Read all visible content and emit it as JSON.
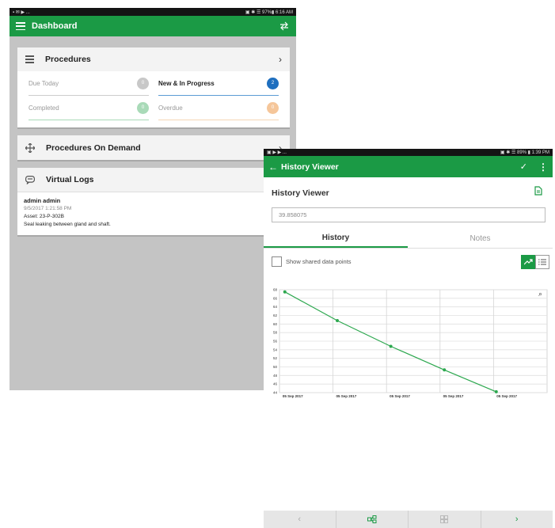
{
  "left": {
    "status": {
      "left": "▪ ✉ ▶ ...",
      "right": "▣ ✱ ☰ 97%▮ 6:16 AM"
    },
    "appbar": {
      "title": "Dashboard"
    },
    "procedures": {
      "title": "Procedures",
      "tiles": [
        {
          "label": "Due Today",
          "count": "0",
          "color": "#c8c8c8",
          "line": "#cccccc",
          "active": false
        },
        {
          "label": "New & In Progress",
          "count": "2",
          "color": "#1f6fbf",
          "line": "#5b9bd5",
          "active": true
        },
        {
          "label": "Completed",
          "count": "0",
          "color": "#a9dab8",
          "line": "#a9dab8",
          "active": false
        },
        {
          "label": "Overdue",
          "count": "0",
          "color": "#f5c69a",
          "line": "#f5d7b5",
          "active": false
        }
      ]
    },
    "on_demand": {
      "title": "Procedures On Demand"
    },
    "virtual_logs": {
      "title": "Virtual Logs",
      "user": "admin admin",
      "time": "9/5/2017 1:21:58 PM",
      "asset": "Asset: 23-P-302B",
      "note": "Seal leaking between gland and shaft."
    }
  },
  "right": {
    "status": {
      "left": "▣ ▶ ▶ ...",
      "right": "▣ ✱ ☰ 89% ▮ 1:39 PM"
    },
    "appbar": {
      "title": "History Viewer"
    },
    "page_title": "History Viewer",
    "value": "39.858075",
    "tabs": {
      "history": "History",
      "notes": "Notes"
    },
    "show_shared": "Show shared data points",
    "colors": {
      "brand": "#1b9a45",
      "line": "#2da84f"
    }
  },
  "chart_data": {
    "type": "line",
    "title": "",
    "xlabel": "",
    "ylabel": "",
    "ylim": [
      44,
      68
    ],
    "yticks": [
      44,
      46,
      48,
      50,
      52,
      54,
      56,
      58,
      60,
      62,
      64,
      66,
      68
    ],
    "xticks": [
      "05 Sep 2017",
      "05 Sep 2017",
      "05 Sep 2017",
      "05 Sep 2017",
      "05 Sep 2017"
    ],
    "series": [
      {
        "x": [
          0.1,
          1.08,
          2.08,
          3.08,
          4.05
        ],
        "y": [
          67.5,
          60.8,
          54.8,
          49.3,
          44.2
        ]
      }
    ],
    "grid": true
  }
}
